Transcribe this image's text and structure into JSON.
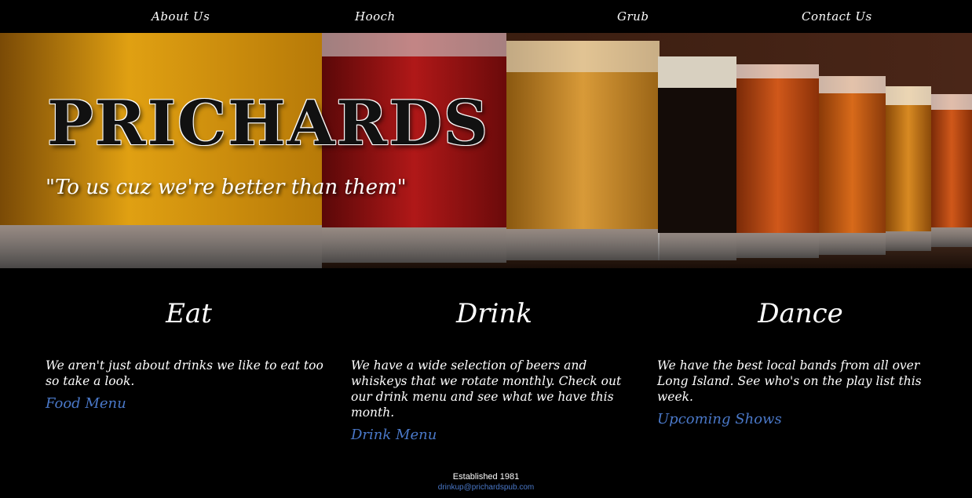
{
  "nav": {
    "items": [
      {
        "label": "About Us"
      },
      {
        "label": "Hooch"
      },
      {
        "label": "Grub"
      },
      {
        "label": "Contact Us"
      }
    ]
  },
  "hero": {
    "title": "PRICHARDS",
    "tagline": "\"To us cuz we're better than them\""
  },
  "columns": [
    {
      "heading": "Eat",
      "text": "We aren't just about drinks we like to eat too so take a look.",
      "link": "Food Menu"
    },
    {
      "heading": "Drink",
      "text": "We have a wide selection of beers and whiskeys that we rotate monthly. Check out our drink menu and see what we have this month.",
      "link": "Drink Menu"
    },
    {
      "heading": "Dance",
      "text": "We have the best local bands from all over Long Island. See who's on the play list this week.",
      "link": "Upcoming Shows"
    }
  ],
  "footer": {
    "established": "Established 1981",
    "email": "drinkup@prichardspub.com"
  },
  "colors": {
    "background": "#000000",
    "link": "#4a78c8",
    "text": "#ffffff"
  }
}
